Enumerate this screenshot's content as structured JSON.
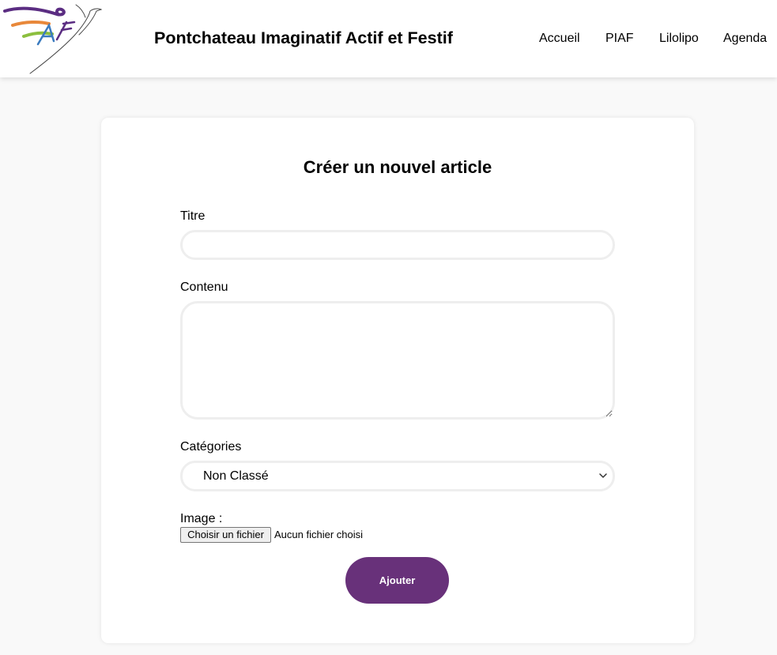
{
  "header": {
    "site_title": "Pontchateau Imaginatif Actif et Festif",
    "logo_icon": "bird-logo-icon",
    "logo_letters": "PIAF",
    "nav": [
      "Accueil",
      "PIAF",
      "Lilolipo",
      "Agenda"
    ]
  },
  "form": {
    "heading": "Créer un nouvel article",
    "title_label": "Titre",
    "title_value": "",
    "content_label": "Contenu",
    "content_value": "",
    "category_label": "Catégories",
    "category_selected": "Non Classé",
    "image_label": "Image :",
    "file_button_label": "Choisir un fichier",
    "file_status": "Aucun fichier choisi",
    "submit_label": "Ajouter"
  },
  "colors": {
    "accent_purple": "#68317a",
    "logo_purple": "#5b2d82",
    "logo_orange": "#e8883a",
    "logo_green": "#8cbf3f",
    "logo_blue": "#3a7bbf",
    "page_background": "#f9f9f9",
    "input_border": "#eeeeee"
  }
}
